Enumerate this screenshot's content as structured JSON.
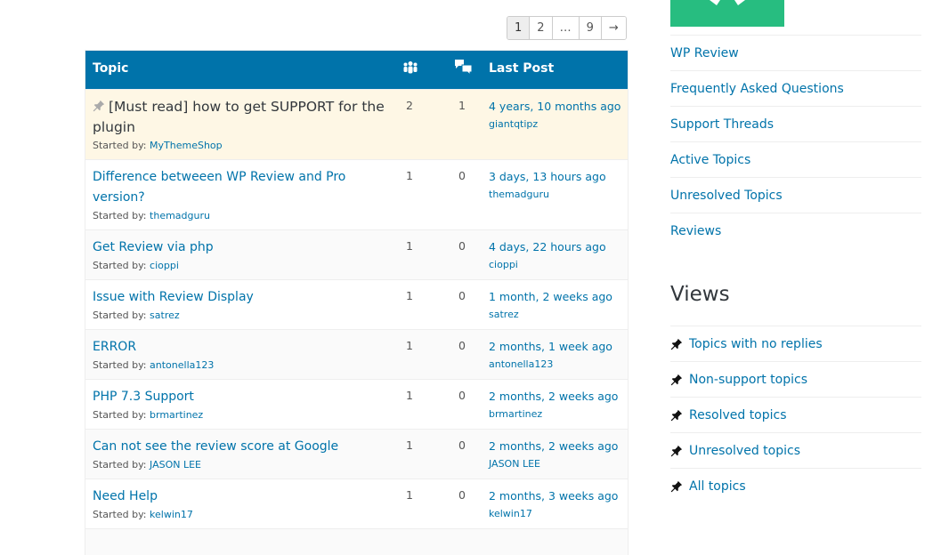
{
  "pagination": {
    "pages": [
      "1",
      "2",
      "…",
      "9",
      "→"
    ],
    "current": "1"
  },
  "table": {
    "headers": {
      "topic": "Topic",
      "voices_icon": "voices-icon",
      "replies_icon": "replies-icon",
      "last_post": "Last Post"
    },
    "started_by_label": "Started by:",
    "rows": [
      {
        "title": "[Must read] how to get SUPPORT for the plugin",
        "sticky": true,
        "author": "MyThemeShop",
        "voices": "2",
        "replies": "1",
        "last_post": "4 years, 10 months ago",
        "last_user": "giantqtipz"
      },
      {
        "title": "Difference betweeen WP Review and Pro version?",
        "sticky": false,
        "author": "themadguru",
        "voices": "1",
        "replies": "0",
        "last_post": "3 days, 13 hours ago",
        "last_user": "themadguru"
      },
      {
        "title": "Get Review via php",
        "sticky": false,
        "author": "cioppi",
        "voices": "1",
        "replies": "0",
        "last_post": "4 days, 22 hours ago",
        "last_user": "cioppi"
      },
      {
        "title": "Issue with Review Display",
        "sticky": false,
        "author": "satrez",
        "voices": "1",
        "replies": "0",
        "last_post": "1 month, 2 weeks ago",
        "last_user": "satrez"
      },
      {
        "title": "ERROR",
        "sticky": false,
        "author": "antonella123",
        "voices": "1",
        "replies": "0",
        "last_post": "2 months, 1 week ago",
        "last_user": "antonella123"
      },
      {
        "title": "PHP 7.3 Support",
        "sticky": false,
        "author": "brmartinez",
        "voices": "1",
        "replies": "0",
        "last_post": "2 months, 2 weeks ago",
        "last_user": "brmartinez"
      },
      {
        "title": "Can not see the review score at Google",
        "sticky": false,
        "author": "JASON LEE",
        "voices": "1",
        "replies": "0",
        "last_post": "2 months, 2 weeks ago",
        "last_user": "JASON LEE"
      },
      {
        "title": "Need Help",
        "sticky": false,
        "author": "kelwin17",
        "voices": "1",
        "replies": "0",
        "last_post": "2 months, 3 weeks ago",
        "last_user": "kelwin17"
      }
    ]
  },
  "sidebar": {
    "links": [
      "WP Review",
      "Frequently Asked Questions",
      "Support Threads",
      "Active Topics",
      "Unresolved Topics",
      "Reviews"
    ],
    "views_title": "Views",
    "views": [
      "Topics with no replies",
      "Non-support topics",
      "Resolved topics",
      "Unresolved topics",
      "All topics"
    ]
  },
  "colors": {
    "header_bg": "#0073aa",
    "link": "#0073aa",
    "sticky_bg": "#fef7e5",
    "banner_green": "#27bd80"
  }
}
